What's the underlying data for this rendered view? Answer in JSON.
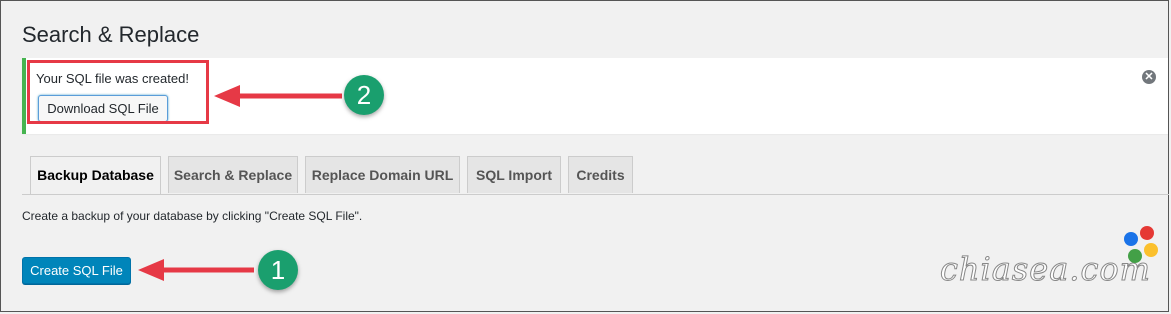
{
  "page": {
    "title": "Search & Replace"
  },
  "notice": {
    "message": "Your SQL file was created!",
    "download_label": "Download SQL File",
    "dismiss_glyph": "✕"
  },
  "tabs": [
    {
      "label": "Backup Database",
      "active": true
    },
    {
      "label": "Search & Replace",
      "active": false
    },
    {
      "label": "Replace Domain URL",
      "active": false
    },
    {
      "label": "SQL Import",
      "active": false
    },
    {
      "label": "Credits",
      "active": false
    }
  ],
  "backup": {
    "description": "Create a backup of your database by clicking \"Create SQL File\".",
    "create_label": "Create SQL File"
  },
  "annotations": {
    "step1": "1",
    "step2": "2",
    "arrow_color": "#e63946",
    "badge_color": "#1a9f6e"
  },
  "watermark": {
    "text": "chiasea.com",
    "dots": [
      "#1a73e8",
      "#e53935",
      "#43a047",
      "#fbc02d"
    ]
  }
}
